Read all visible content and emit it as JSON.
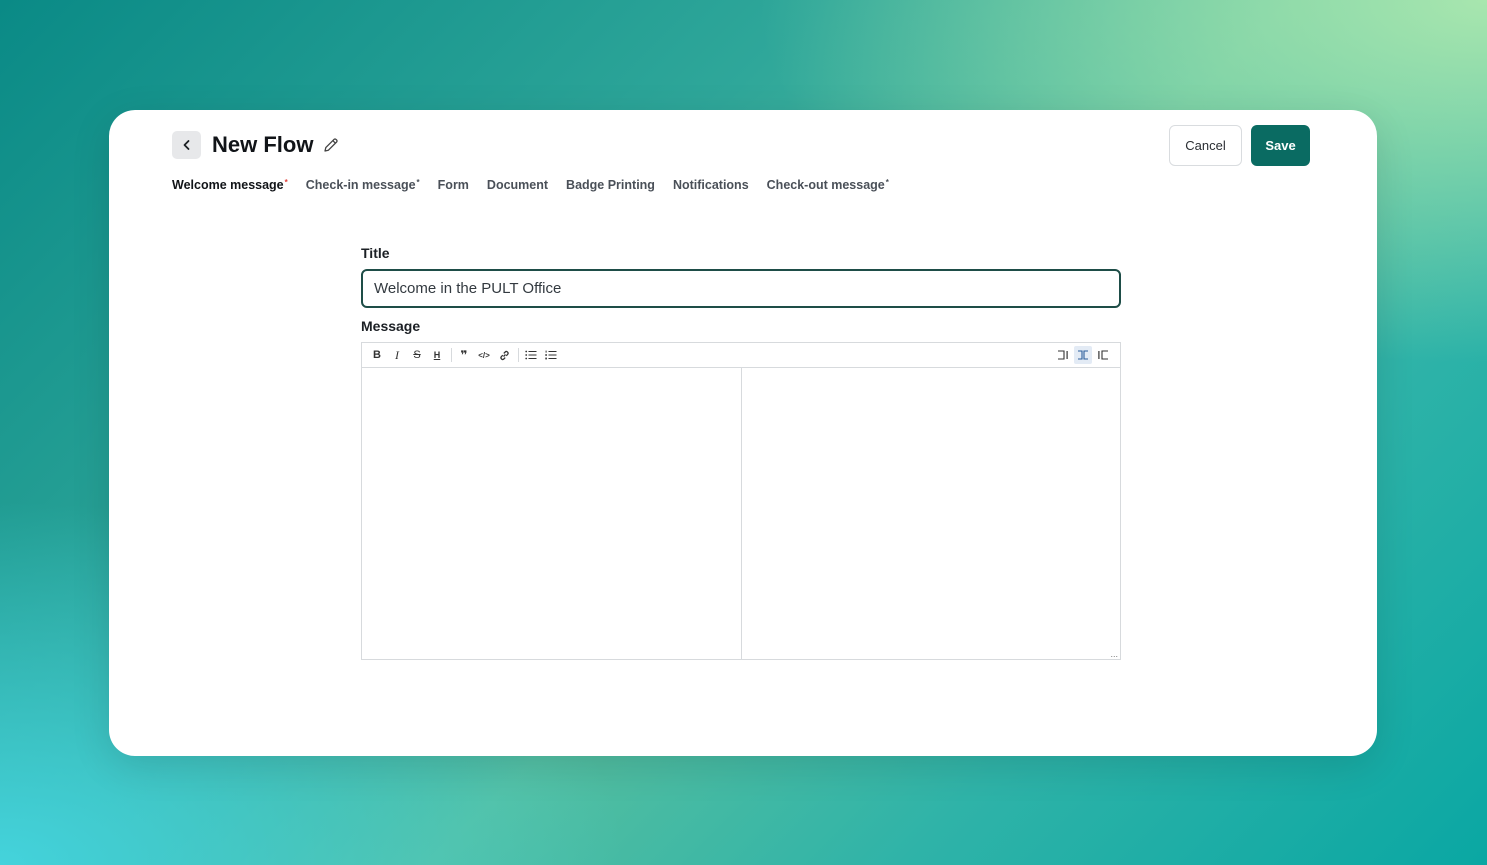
{
  "header": {
    "title": "New Flow",
    "cancel_label": "Cancel",
    "save_label": "Save"
  },
  "tabs": [
    {
      "label": "Welcome message",
      "required": "*",
      "active": true
    },
    {
      "label": "Check-in message",
      "required": "*",
      "active": false
    },
    {
      "label": "Form",
      "required": "",
      "active": false
    },
    {
      "label": "Document",
      "required": "",
      "active": false
    },
    {
      "label": "Badge Printing",
      "required": "",
      "active": false
    },
    {
      "label": "Notifications",
      "required": "",
      "active": false
    },
    {
      "label": "Check-out message",
      "required": "*",
      "active": false
    }
  ],
  "form": {
    "title_label": "Title",
    "title_value": "Welcome in the PULT Office",
    "message_label": "Message"
  },
  "toolbar": {
    "bold": "B",
    "italic": "I",
    "strike": "S",
    "heading": "H",
    "quote": "❞",
    "code": "</>",
    "resize": "..."
  },
  "colors": {
    "primary": "#0a6b62",
    "required": "#e0403a"
  }
}
